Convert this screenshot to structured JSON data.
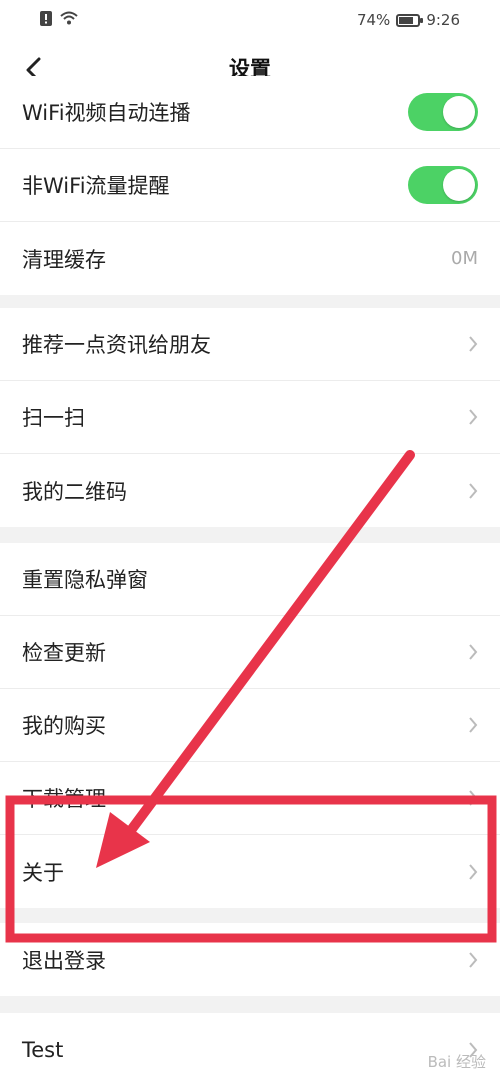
{
  "status": {
    "battery": "74%",
    "time": "9:26",
    "battery_level": 0.74
  },
  "nav": {
    "title": "设置"
  },
  "group1": [
    {
      "label": "WiFi视频自动连播",
      "type": "toggle",
      "on": true
    },
    {
      "label": "非WiFi流量提醒",
      "type": "toggle",
      "on": true
    },
    {
      "label": "清理缓存",
      "type": "value",
      "value": "0M"
    }
  ],
  "group2": [
    {
      "label": "推荐一点资讯给朋友"
    },
    {
      "label": "扫一扫"
    },
    {
      "label": "我的二维码"
    }
  ],
  "group3": [
    {
      "label": "重置隐私弹窗"
    },
    {
      "label": "检查更新"
    },
    {
      "label": "我的购买"
    },
    {
      "label": "下载管理"
    },
    {
      "label": "关于"
    }
  ],
  "group4": [
    {
      "label": "退出登录"
    }
  ],
  "group5": [
    {
      "label": "Test"
    }
  ],
  "colors": {
    "toggle_on": "#4cd265",
    "annotation": "#e8344a"
  },
  "watermark": "Bai 经验"
}
